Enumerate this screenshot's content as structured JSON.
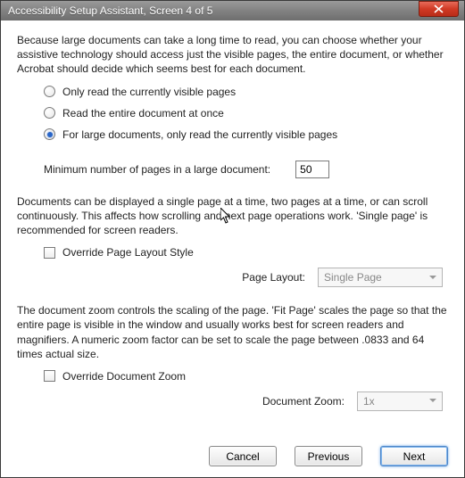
{
  "window": {
    "title": "Accessibility Setup Assistant, Screen 4 of 5"
  },
  "intro": "Because large documents can take a long time to read, you can choose whether your assistive technology should access just the visible pages, the entire document, or whether Acrobat should decide which seems best for each document.",
  "reading_mode": {
    "options": [
      "Only read the currently visible pages",
      "Read the entire document at once",
      "For large documents, only read the currently visible pages"
    ],
    "selected_index": 2
  },
  "min_pages": {
    "label": "Minimum number of pages in a large document:",
    "value": "50"
  },
  "layout_section": {
    "text": "Documents can be displayed a single page at a time, two pages at a time, or can scroll continuously. This affects how scrolling and next page operations work. 'Single page' is recommended for screen readers.",
    "override_label": "Override Page Layout Style",
    "combo_label": "Page Layout:",
    "combo_value": "Single Page"
  },
  "zoom_section": {
    "text": "The document zoom controls the scaling of the page. 'Fit Page' scales the page so that the entire page is visible in the window and usually works best for screen readers and magnifiers. A numeric zoom factor can be set to scale the page between .0833 and 64 times actual size.",
    "override_label": "Override Document Zoom",
    "combo_label": "Document Zoom:",
    "combo_value": "1x"
  },
  "buttons": {
    "cancel": "Cancel",
    "previous": "Previous",
    "next": "Next"
  }
}
